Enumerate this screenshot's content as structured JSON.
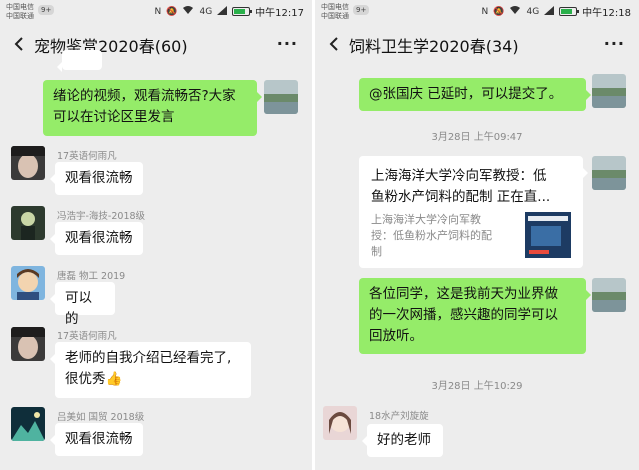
{
  "left": {
    "status": {
      "carrier1": "中国电信",
      "carrier2": "中国联通",
      "badge": "9+",
      "signal": "4G",
      "time": "中午12:17"
    },
    "title": "宠物鉴赏2020春(60)",
    "messages": {
      "m1": {
        "line1": "绪论的视频，观看流畅否?大家",
        "line2": "可以在讨论区里发言"
      },
      "m2": {
        "sender": "17英语何雨凡",
        "text": "观看很流畅"
      },
      "m3": {
        "sender": "冯浩宇-海技-2018级",
        "text": "观看很流畅"
      },
      "m4": {
        "sender": "唐磊 物工 2019",
        "text": "可以的"
      },
      "m5": {
        "sender": "17英语何雨凡",
        "line1": "老师的自我介绍已经看完了,",
        "line2": "很优秀",
        "emoji": "👍"
      },
      "m6": {
        "sender": "吕美如 国贸 2018级",
        "text": "观看很流畅"
      }
    }
  },
  "right": {
    "status": {
      "carrier1": "中国电信",
      "carrier2": "中国联通",
      "badge": "9+",
      "signal": "4G",
      "time": "中午12:18"
    },
    "title": "饲料卫生学2020春(34)",
    "messages": {
      "m1": {
        "text": "@张国庆  已延时，可以提交了。"
      },
      "ts1": "3月28日 上午09:47",
      "card": {
        "title1": "上海海洋大学冷向军教授：低",
        "title2": "鱼粉水产饲料的配制 正在直...",
        "desc1": "上海海洋大学冷向军教",
        "desc2": "授：低鱼粉水产饲料的配",
        "desc3": "制"
      },
      "m2": {
        "line1": "各位同学，这是我前天为业界做",
        "line2": "的一次网播，感兴趣的同学可以",
        "line3": "回放听。"
      },
      "ts2": "3月28日 上午10:29",
      "m3": {
        "sender": "18水产刘旋旋",
        "text": "好的老师"
      }
    }
  },
  "colors": {
    "outgoing_bubble": "#95ec69",
    "incoming_bubble": "#ffffff",
    "background": "#ededed"
  }
}
